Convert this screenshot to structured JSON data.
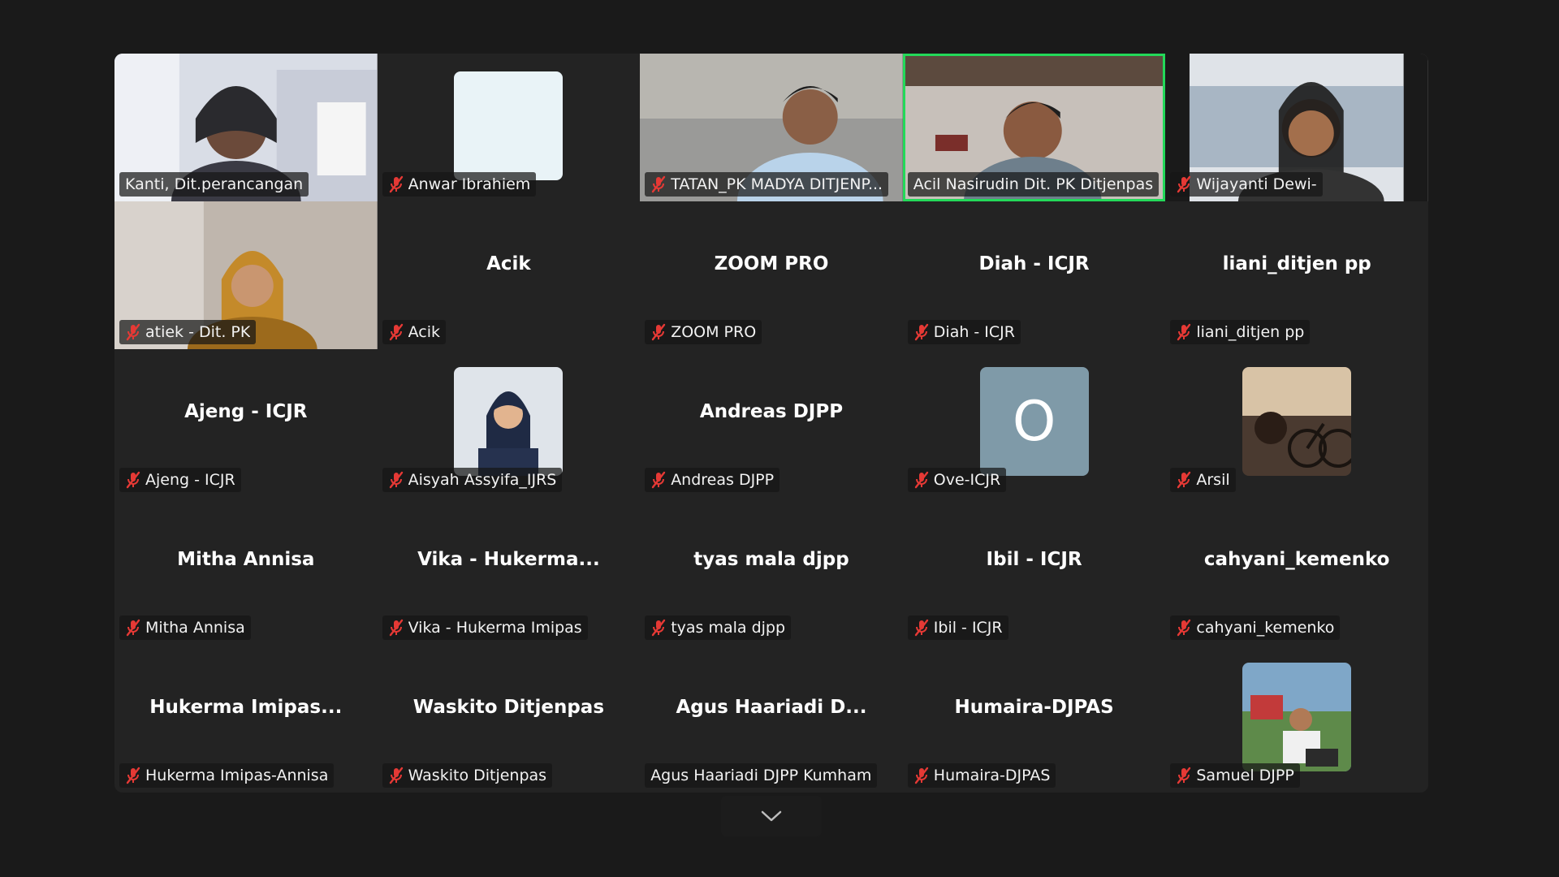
{
  "colors": {
    "background": "#1a1a1a",
    "tile": "#232323",
    "active_speaker_border": "#23d959",
    "muted_icon": "#e53935",
    "avatar_initial_bg": "#7f9aa8"
  },
  "participants": [
    {
      "label": "Kanti, Dit.perancangan",
      "muted": false,
      "view": "video"
    },
    {
      "label": "Anwar Ibrahiem",
      "muted": true,
      "view": "avatar-blank"
    },
    {
      "label": "TATAN_PK MADYA DITJENP...",
      "muted": true,
      "view": "video"
    },
    {
      "label": "Acil Nasirudin Dit. PK Ditjenpas",
      "muted": false,
      "view": "video",
      "active_speaker": true
    },
    {
      "label": "Wijayanti Dewi-",
      "muted": true,
      "view": "video"
    },
    {
      "label": "atiek - Dit. PK",
      "muted": true,
      "view": "video"
    },
    {
      "label": "Acik",
      "center_name": "Acik",
      "muted": true,
      "view": "name"
    },
    {
      "label": "ZOOM PRO",
      "center_name": "ZOOM PRO",
      "muted": true,
      "view": "name"
    },
    {
      "label": "Diah - ICJR",
      "center_name": "Diah - ICJR",
      "muted": true,
      "view": "name"
    },
    {
      "label": "liani_ditjen pp",
      "center_name": "liani_ditjen pp",
      "muted": true,
      "view": "name"
    },
    {
      "label": "Ajeng - ICJR",
      "center_name": "Ajeng - ICJR",
      "muted": true,
      "view": "name"
    },
    {
      "label": "Aisyah Assyifa_IJRS",
      "muted": true,
      "view": "avatar-photo"
    },
    {
      "label": "Andreas DJPP",
      "center_name": "Andreas DJPP",
      "muted": true,
      "view": "name"
    },
    {
      "label": "Ove-ICJR",
      "avatar_initial": "O",
      "muted": true,
      "view": "avatar-initial"
    },
    {
      "label": "Arsil",
      "muted": true,
      "view": "avatar-photo"
    },
    {
      "label": "Mitha Annisa",
      "center_name": "Mitha Annisa",
      "muted": true,
      "view": "name"
    },
    {
      "label": "Vika - Hukerma Imipas",
      "center_name": "Vika  -  Hukerma...",
      "muted": true,
      "view": "name"
    },
    {
      "label": "tyas mala djpp",
      "center_name": "tyas mala djpp",
      "muted": true,
      "view": "name"
    },
    {
      "label": "Ibil - ICJR",
      "center_name": "Ibil - ICJR",
      "muted": true,
      "view": "name"
    },
    {
      "label": "cahyani_kemenko",
      "center_name": "cahyani_kemenko",
      "muted": true,
      "view": "name"
    },
    {
      "label": "Hukerma Imipas-Annisa",
      "center_name": "Hukerma  Imipas...",
      "muted": true,
      "view": "name"
    },
    {
      "label": "Waskito Ditjenpas",
      "center_name": "Waskito Ditjenpas",
      "muted": true,
      "view": "name"
    },
    {
      "label": "Agus Haariadi DJPP Kumham",
      "center_name": "Agus  Haariadi  D...",
      "muted": false,
      "view": "name"
    },
    {
      "label": "Humaira-DJPAS",
      "center_name": "Humaira-DJPAS",
      "muted": true,
      "view": "name"
    },
    {
      "label": "Samuel DJPP",
      "muted": true,
      "view": "avatar-photo"
    }
  ],
  "scroll_control": {
    "icon": "chevron-down-icon"
  }
}
